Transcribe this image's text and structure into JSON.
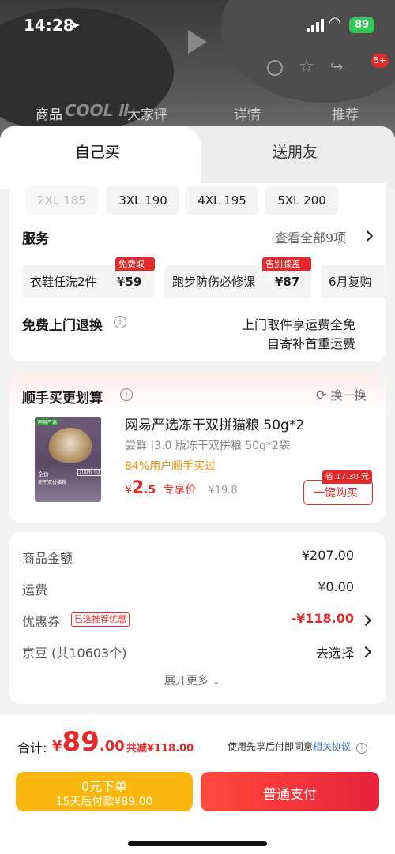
{
  "status": {
    "time": "14:28",
    "battery": "89"
  },
  "background": {
    "tabs": [
      "商品",
      "大家评",
      "详情",
      "推荐"
    ],
    "badge": "5+",
    "watermark": "COOL Ⅱ"
  },
  "sheet_tabs": {
    "self_buy": "自己买",
    "gift": "送朋友"
  },
  "sizes": [
    "2XL 185",
    "3XL 190",
    "4XL 195",
    "5XL 200"
  ],
  "services": {
    "title": "服务",
    "view_all": "查看全部9项",
    "items": [
      {
        "name": "衣鞋任洗2件",
        "price": "¥59",
        "tag": "免费取送"
      },
      {
        "name": "跑步防伤必修课",
        "price": "¥87",
        "tag": "告别膝盖痛"
      },
      {
        "name": "6月复购",
        "price": "",
        "tag": ""
      }
    ]
  },
  "returns": {
    "title": "免费上门退换",
    "line1": "上门取件享运费全免",
    "line2": "自寄补首重运费"
  },
  "addon": {
    "title": "顺手买更划算",
    "swap": "换一换",
    "product_name": "网易严选冻干双拼猫粮 50g*2",
    "desc": "尝鲜 |3.0 版冻干双拼粮 50g*2袋",
    "bought": "84%用户顺手买过",
    "price_symbol": "¥",
    "price_int": "2",
    "price_dec": ".5",
    "price_label": "专享价",
    "orig_price": "¥19.8",
    "save_tag": "省 17.30 元",
    "buy_btn": "一键购买",
    "img_brand": "网易严选",
    "img_text1": "全价",
    "img_text2": "冻干双拼猫粮",
    "img_badge": "100% 03"
  },
  "summary": {
    "rows": [
      {
        "label": "商品金额",
        "value": "¥207.00"
      },
      {
        "label": "运费",
        "value": "¥0.00"
      },
      {
        "label": "优惠券",
        "tag": "已选推荐优惠",
        "value": "-¥118.00"
      },
      {
        "label": "京豆 (共10603个)",
        "value": "去选择"
      }
    ],
    "expand": "展开更多"
  },
  "footer": {
    "total_label": "合计:",
    "total_symbol": "¥",
    "total_int": "89",
    "total_dec": ".00",
    "discount": "共减¥118.00",
    "agree_text": "使用先享后付即同意",
    "agree_link": "相关协议",
    "btn_paylater_1": "0元下单",
    "btn_paylater_2": "15天后付款¥89.00",
    "btn_pay": "普通支付"
  },
  "colors": {
    "red": "#e22a2a",
    "yellow": "#f6b400",
    "orange": "#f08c00",
    "link": "#2f6fd6"
  }
}
